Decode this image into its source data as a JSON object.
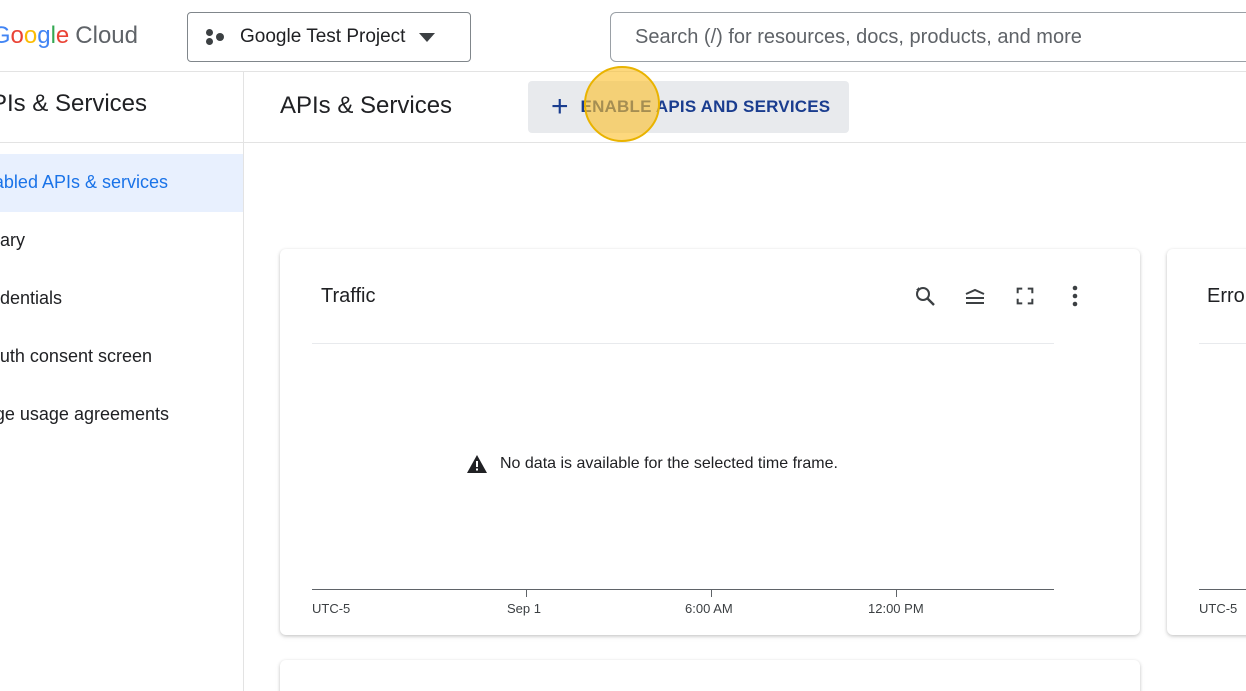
{
  "header": {
    "logo": {
      "google": "Google",
      "cloud": "Cloud"
    },
    "project_label": "Google Test Project",
    "search_placeholder": "Search (/) for resources, docs, products, and more"
  },
  "sidebar": {
    "title": "APIs & Services",
    "items": [
      {
        "label": "Enabled APIs & services",
        "active": true
      },
      {
        "label": "Library",
        "active": false
      },
      {
        "label": "Credentials",
        "active": false
      },
      {
        "label": "OAuth consent screen",
        "active": false
      },
      {
        "label": "Page usage agreements",
        "active": false
      }
    ]
  },
  "main": {
    "title": "APIs & Services",
    "enable_button": "ENABLE APIS AND SERVICES"
  },
  "traffic_card": {
    "title": "Traffic",
    "toolbar_icons": [
      "reset-zoom-icon",
      "legend-icon",
      "fullscreen-icon",
      "more-vert-icon"
    ],
    "no_data_message": "No data is available for the selected time frame.",
    "timezone": "UTC-5",
    "ticks": [
      "Sep 1",
      "6:00 AM",
      "12:00 PM"
    ]
  },
  "errors_card": {
    "title": "Errors",
    "timezone": "UTC-5"
  },
  "colors": {
    "accent": "#1a73e8",
    "button_text": "#1a3d8f",
    "highlight": "#fbc02d"
  }
}
